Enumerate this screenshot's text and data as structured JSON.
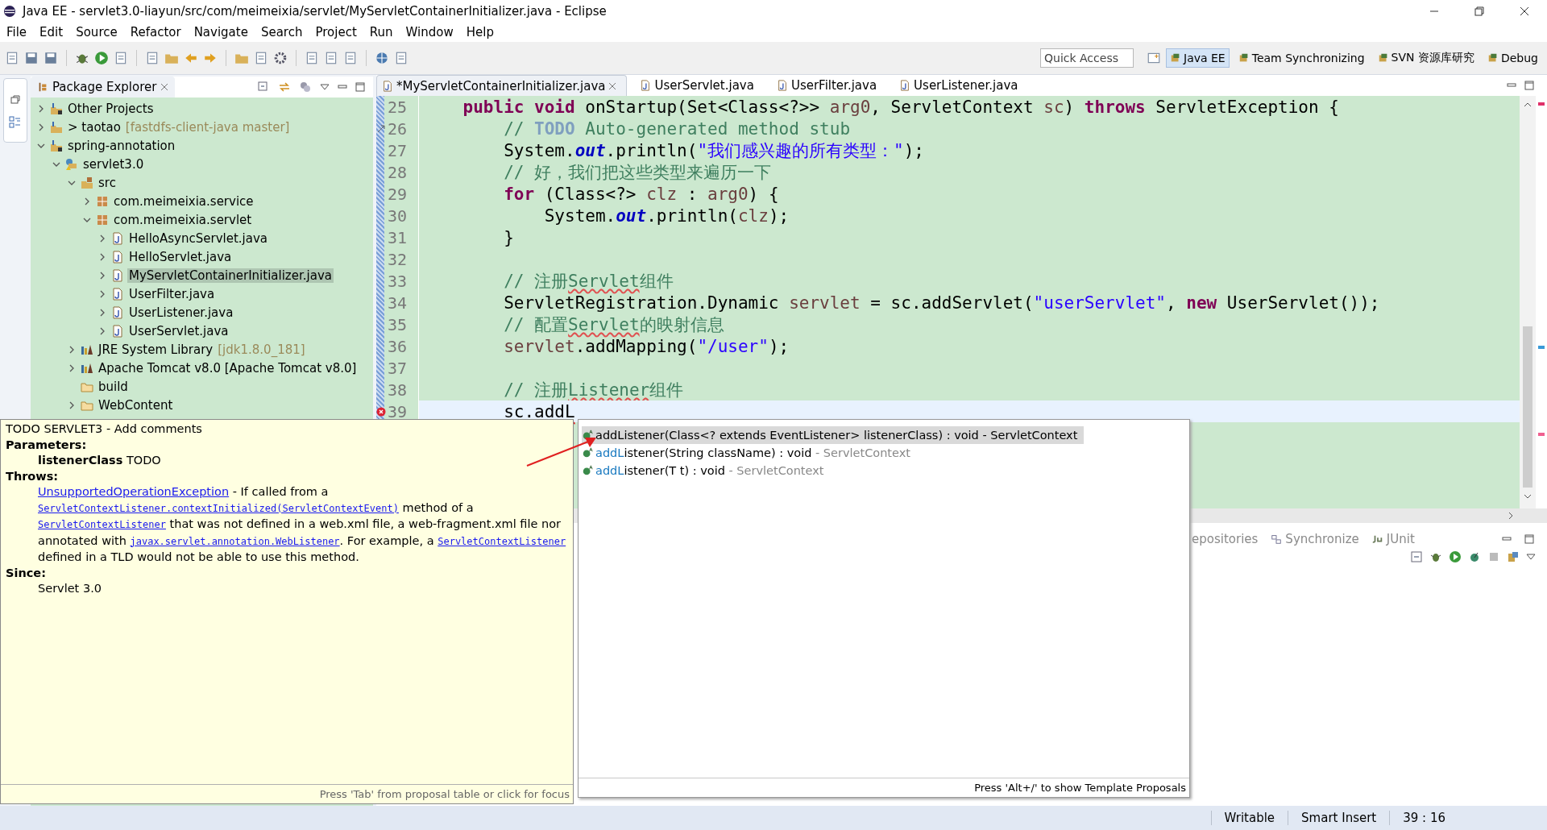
{
  "window": {
    "title": "Java EE - servlet3.0-liayun/src/com/meimeixia/servlet/MyServletContainerInitializer.java - Eclipse"
  },
  "menu": [
    "File",
    "Edit",
    "Source",
    "Refactor",
    "Navigate",
    "Search",
    "Project",
    "Run",
    "Window",
    "Help"
  ],
  "quick_access": {
    "placeholder": "Quick Access"
  },
  "perspectives": [
    {
      "label": "Java EE",
      "selected": true
    },
    {
      "label": "Team Synchronizing",
      "selected": false
    },
    {
      "label": "SVN 资源库研究",
      "selected": false
    },
    {
      "label": "Debug",
      "selected": false
    }
  ],
  "package_explorer": {
    "title": "Package Explorer",
    "tree": [
      {
        "label": "Other Projects",
        "kind": "working-set",
        "expanded": false,
        "selected": false
      },
      {
        "label": "> taotao",
        "decoration": "[fastdfs-client-java master]",
        "kind": "project",
        "expanded": false,
        "selected": false
      },
      {
        "label": "spring-annotation",
        "kind": "working-set",
        "expanded": true,
        "selected": false,
        "children": [
          {
            "label": "servlet3.0",
            "kind": "web-project",
            "expanded": true,
            "selected": false,
            "children": [
              {
                "label": "src",
                "kind": "source-folder",
                "expanded": true,
                "selected": false,
                "children": [
                  {
                    "label": "com.meimeixia.service",
                    "kind": "package",
                    "expanded": false,
                    "selected": false
                  },
                  {
                    "label": "com.meimeixia.servlet",
                    "kind": "package",
                    "expanded": true,
                    "selected": false,
                    "children": [
                      {
                        "label": "HelloAsyncServlet.java",
                        "kind": "java",
                        "expanded": false,
                        "selected": false
                      },
                      {
                        "label": "HelloServlet.java",
                        "kind": "java",
                        "expanded": false,
                        "selected": false
                      },
                      {
                        "label": "MyServletContainerInitializer.java",
                        "kind": "java",
                        "expanded": false,
                        "selected": true
                      },
                      {
                        "label": "UserFilter.java",
                        "kind": "java",
                        "expanded": false,
                        "selected": false
                      },
                      {
                        "label": "UserListener.java",
                        "kind": "java",
                        "expanded": false,
                        "selected": false
                      },
                      {
                        "label": "UserServlet.java",
                        "kind": "java",
                        "expanded": false,
                        "selected": false
                      }
                    ]
                  }
                ]
              },
              {
                "label": "JRE System Library",
                "decoration": "[jdk1.8.0_181]",
                "kind": "library",
                "expanded": false,
                "selected": false
              },
              {
                "label": "Apache Tomcat v8.0 [Apache Tomcat v8.0]",
                "kind": "library",
                "expanded": false,
                "selected": false
              },
              {
                "label": "build",
                "kind": "folder",
                "selected": false
              },
              {
                "label": "WebContent",
                "kind": "folder",
                "expanded": false,
                "selected": false
              }
            ]
          }
        ]
      }
    ]
  },
  "editor": {
    "tabs": [
      {
        "label": "*MyServletContainerInitializer.java",
        "selected": true
      },
      {
        "label": "UserServlet.java",
        "selected": false
      },
      {
        "label": "UserFilter.java",
        "selected": false
      },
      {
        "label": "UserListener.java",
        "selected": false
      }
    ],
    "lines": [
      {
        "number": "25",
        "current": false,
        "segments": [
          {
            "text": "    public",
            "kind": "kw"
          },
          {
            "text": " void",
            "kind": "kw"
          },
          {
            "text": " onStartup(Set<Class<?>> ",
            "kind": "plain"
          },
          {
            "text": "arg0",
            "kind": "var"
          },
          {
            "text": ", ServletContext ",
            "kind": "plain"
          },
          {
            "text": "sc",
            "kind": "var"
          },
          {
            "text": ") ",
            "kind": "plain"
          },
          {
            "text": "throws",
            "kind": "kw"
          },
          {
            "text": " ServletException {",
            "kind": "plain"
          }
        ]
      },
      {
        "number": "26",
        "current": false,
        "kind": "override",
        "segments": [
          {
            "text": "        // ",
            "kind": "comment"
          },
          {
            "text": "TODO",
            "kind": "todo"
          },
          {
            "text": " Auto-generated method stub",
            "kind": "comment"
          }
        ]
      },
      {
        "number": "27",
        "current": false,
        "segments": [
          {
            "text": "        System.",
            "kind": "plain"
          },
          {
            "text": "out",
            "kind": "field"
          },
          {
            "text": ".println(",
            "kind": "plain"
          },
          {
            "text": "\"我们感兴趣的所有类型：\"",
            "kind": "str"
          },
          {
            "text": ");",
            "kind": "plain"
          }
        ]
      },
      {
        "number": "28",
        "current": false,
        "segments": [
          {
            "text": "        // 好，我们把这些类型来遍历一下",
            "kind": "comment"
          }
        ]
      },
      {
        "number": "29",
        "current": false,
        "segments": [
          {
            "text": "        for",
            "kind": "kw"
          },
          {
            "text": " (Class<?> ",
            "kind": "plain"
          },
          {
            "text": "clz",
            "kind": "var"
          },
          {
            "text": " : ",
            "kind": "plain"
          },
          {
            "text": "arg0",
            "kind": "var"
          },
          {
            "text": ") {",
            "kind": "plain"
          }
        ]
      },
      {
        "number": "30",
        "current": false,
        "segments": [
          {
            "text": "            System.",
            "kind": "plain"
          },
          {
            "text": "out",
            "kind": "field"
          },
          {
            "text": ".println(",
            "kind": "plain"
          },
          {
            "text": "clz",
            "kind": "var"
          },
          {
            "text": ");",
            "kind": "plain"
          }
        ]
      },
      {
        "number": "31",
        "current": false,
        "segments": [
          {
            "text": "        }",
            "kind": "plain"
          }
        ]
      },
      {
        "number": "32",
        "current": false
      },
      {
        "number": "33",
        "current": false,
        "segments": [
          {
            "text": "        // 注册",
            "kind": "comment"
          },
          {
            "text": "Servlet",
            "kind": "spell"
          },
          {
            "text": "组件",
            "kind": "comment"
          }
        ]
      },
      {
        "number": "34",
        "current": false,
        "segments": [
          {
            "text": "        ServletRegistration.Dynamic ",
            "kind": "plain"
          },
          {
            "text": "servlet",
            "kind": "var"
          },
          {
            "text": " = sc.addServlet(",
            "kind": "plain"
          },
          {
            "text": "\"userServlet\"",
            "kind": "str"
          },
          {
            "text": ", ",
            "kind": "plain"
          },
          {
            "text": "new",
            "kind": "kw"
          },
          {
            "text": " UserServlet());",
            "kind": "plain"
          }
        ]
      },
      {
        "number": "35",
        "current": false,
        "segments": [
          {
            "text": "        // 配置",
            "kind": "comment"
          },
          {
            "text": "Servlet",
            "kind": "spell"
          },
          {
            "text": "的映射信息",
            "kind": "comment"
          }
        ]
      },
      {
        "number": "36",
        "current": false,
        "segments": [
          {
            "text": "        servlet",
            "kind": "var"
          },
          {
            "text": ".addMapping(",
            "kind": "plain"
          },
          {
            "text": "\"/user\"",
            "kind": "str"
          },
          {
            "text": ");",
            "kind": "plain"
          }
        ]
      },
      {
        "number": "37",
        "current": false
      },
      {
        "number": "38",
        "current": false,
        "segments": [
          {
            "text": "        // 注册",
            "kind": "comment"
          },
          {
            "text": "Listener",
            "kind": "spell"
          },
          {
            "text": "组件",
            "kind": "comment"
          }
        ]
      },
      {
        "number": "39",
        "current": true,
        "kind": "error",
        "segments": [
          {
            "text": "        sc.addL",
            "kind": "error"
          }
        ]
      }
    ]
  },
  "javadoc": {
    "header": "TODO SERVLET3 - Add comments",
    "sections": [
      {
        "heading": "Parameters:",
        "segments": [
          {
            "text": "listenerClass",
            "kind": "param"
          },
          {
            "text": " TODO",
            "kind": "text"
          }
        ]
      },
      {
        "heading": "Throws:",
        "segments": [
          {
            "text": "UnsupportedOperationException",
            "kind": "link"
          },
          {
            "text": " - If called from a ",
            "kind": "text"
          },
          {
            "text": "ServletContextListener.contextInitialized(ServletContextEvent)",
            "kind": "code-link"
          },
          {
            "text": " method of a ",
            "kind": "text"
          },
          {
            "text": "ServletContextListener",
            "kind": "code-link"
          },
          {
            "text": " that was not defined in a web.xml file, a web-fragment.xml file nor annotated with ",
            "kind": "text"
          },
          {
            "text": "javax.servlet.annotation.WebListener",
            "kind": "code-link"
          },
          {
            "text": ". For example, a ",
            "kind": "text"
          },
          {
            "text": "ServletContextListener",
            "kind": "code-link"
          },
          {
            "text": " defined in a TLD would not be able to use this method.",
            "kind": "text"
          }
        ]
      },
      {
        "heading": "Since:",
        "segments": [
          {
            "text": "Servlet 3.0",
            "kind": "text"
          }
        ]
      }
    ],
    "footer": "Press 'Tab' from proposal table or click for focus"
  },
  "proposals": {
    "items": [
      {
        "prefix": "addL",
        "rest": "istener(Class<? extends EventListener> listenerClass) : void",
        "qualifier": " - ServletContext",
        "selected": true
      },
      {
        "prefix": "addL",
        "rest": "istener(String className) : void",
        "qualifier": " - ServletContext",
        "selected": false
      },
      {
        "prefix": "addL",
        "rest": "istener(T t) : void",
        "qualifier": " - ServletContext",
        "selected": false
      }
    ],
    "footer": "Press 'Alt+/' to show Template Proposals"
  },
  "bottom_panel": {
    "tabs": [
      {
        "label": "epositories",
        "kind": "plain"
      },
      {
        "label": "Synchronize",
        "kind": "sync"
      },
      {
        "label": "JUnit",
        "kind": "junit"
      }
    ]
  },
  "status_bar": [
    "Writable",
    "Smart Insert",
    "39 : 16"
  ]
}
